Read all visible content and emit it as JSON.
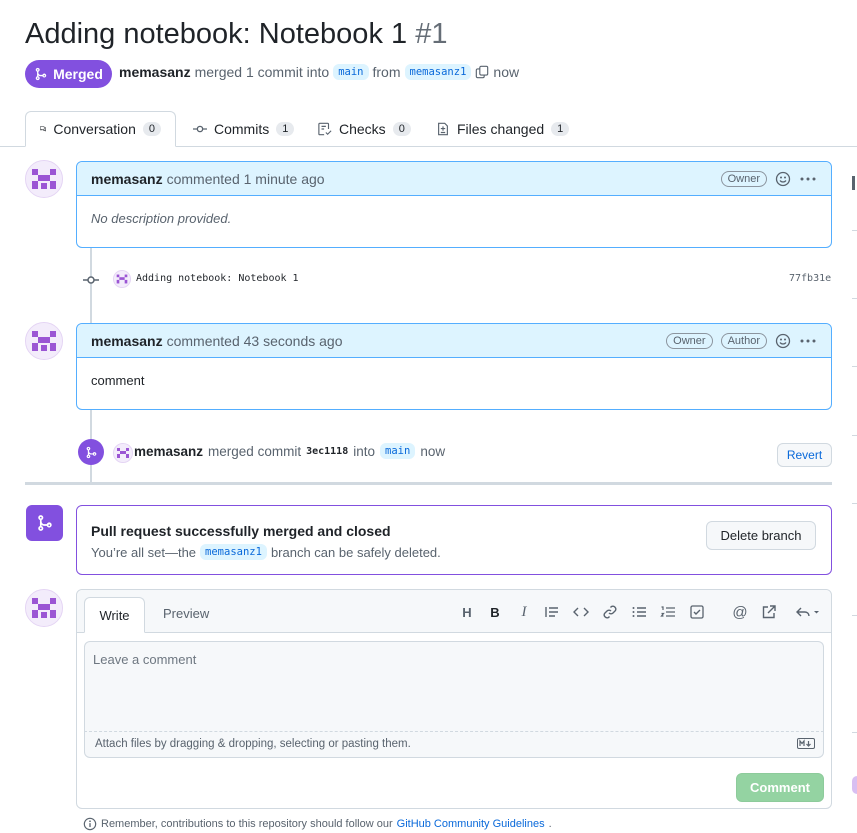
{
  "pr": {
    "title": "Adding notebook: Notebook 1",
    "number": "#1",
    "state": "Merged",
    "author": "memasanz",
    "meta_merged": "merged 1 commit into",
    "base_branch": "main",
    "meta_from": "from",
    "head_branch": "memasanz1",
    "time": "now"
  },
  "tabs": [
    {
      "label": "Conversation",
      "count": "0"
    },
    {
      "label": "Commits",
      "count": "1"
    },
    {
      "label": "Checks",
      "count": "0"
    },
    {
      "label": "Files changed",
      "count": "1"
    }
  ],
  "comment1": {
    "author": "memasanz",
    "action": "commented 1 minute ago",
    "badge": "Owner",
    "body": "No description provided."
  },
  "commit": {
    "message": "Adding notebook: Notebook 1",
    "sha": "77fb31e"
  },
  "comment2": {
    "author": "memasanz",
    "action": "commented 43 seconds ago",
    "badges": [
      "Owner",
      "Author"
    ],
    "body": "comment"
  },
  "merge_event": {
    "author": "memasanz",
    "text1": "merged commit",
    "sha": "3ec1118",
    "text2": "into",
    "branch": "main",
    "time": "now",
    "revert_label": "Revert"
  },
  "merged_box": {
    "title": "Pull request successfully merged and closed",
    "text_before": "You’re all set—the",
    "branch": "memasanz1",
    "text_after": "branch can be safely deleted.",
    "delete_label": "Delete branch"
  },
  "editor": {
    "write_tab": "Write",
    "preview_tab": "Preview",
    "placeholder": "Leave a comment",
    "attach_text": "Attach files by dragging & dropping, selecting or pasting them.",
    "submit_label": "Comment",
    "toolbar": [
      "heading-icon",
      "bold-icon",
      "italic-icon",
      "quote-icon",
      "code-icon",
      "link-icon",
      "unordered-list-icon",
      "ordered-list-icon",
      "task-list-icon",
      "mention-icon",
      "reference-icon",
      "reply-icon"
    ]
  },
  "footer": {
    "text": "Remember, contributions to this repository should follow our",
    "link": "GitHub Community Guidelines",
    "end": "."
  },
  "colors": {
    "merged": "#8250df",
    "link": "#0969da",
    "comment_header": "#ddf4ff",
    "comment_border": "#54aeff",
    "comment_button": "#94d3a2"
  }
}
